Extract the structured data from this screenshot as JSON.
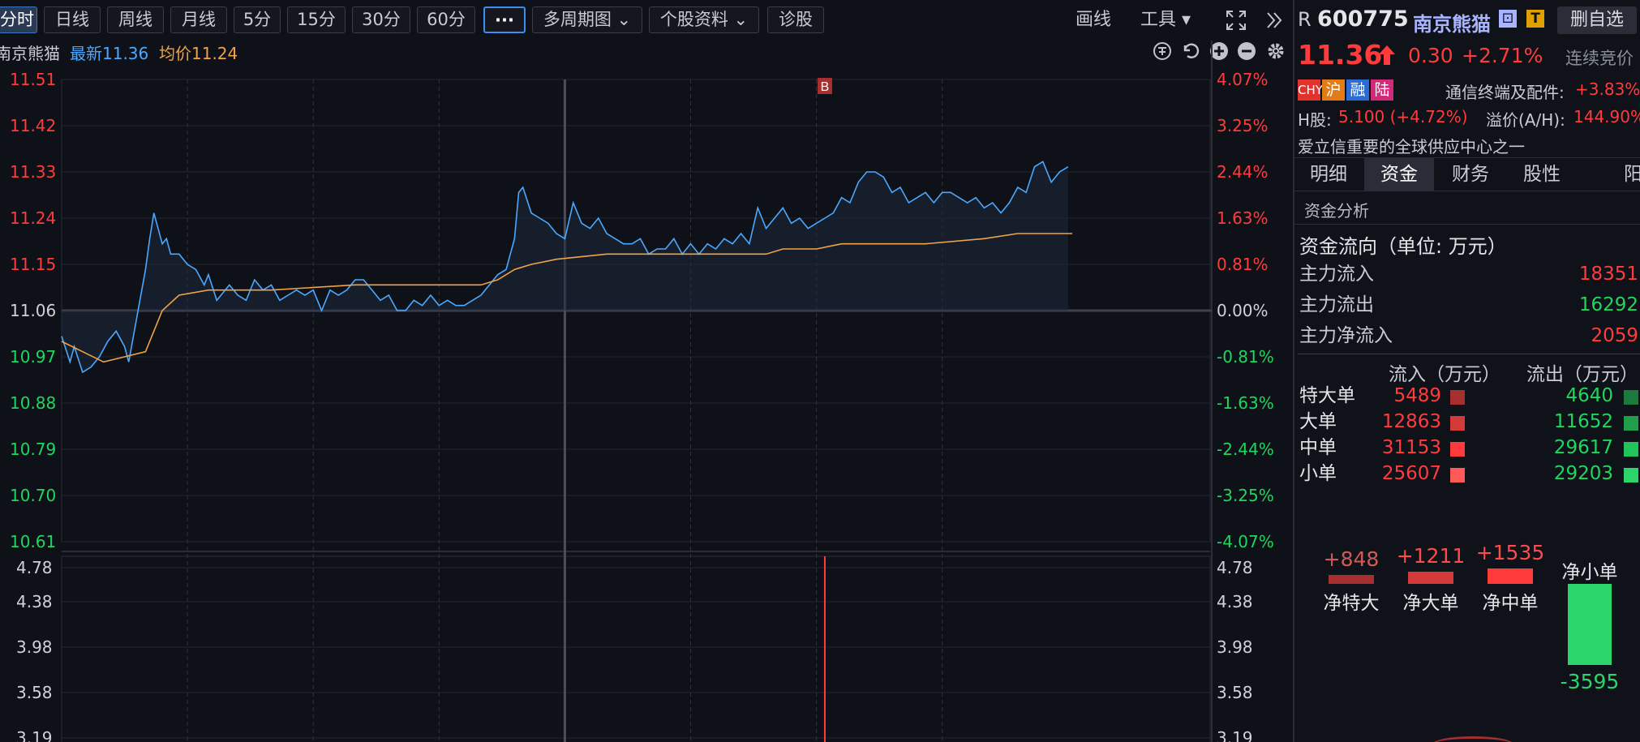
{
  "toolbar": {
    "periods": [
      "分时",
      "日线",
      "周线",
      "月线",
      "5分",
      "15分",
      "30分",
      "60分"
    ],
    "more_label": "···",
    "multi_label": "多周期图 ⌄",
    "profile_label": "个股资料 ⌄",
    "diagnose_label": "诊股",
    "draw_label": "画线",
    "tools_label": "工具 ▾",
    "fullscreen_icon": "fullscreen-icon",
    "collapse_icon": "double-chevron-right-icon"
  },
  "infobar": {
    "name": "南京熊猫",
    "latest": "最新11.36",
    "avg": "均价11.24"
  },
  "marker": "B",
  "price_axis": {
    "left": [
      "11.51",
      "11.42",
      "11.33",
      "11.24",
      "11.15",
      "11.06",
      "10.97",
      "10.88",
      "10.79",
      "10.70",
      "10.61"
    ],
    "right": [
      "4.07%",
      "3.25%",
      "2.44%",
      "1.63%",
      "0.81%",
      "0.00%",
      "-0.81%",
      "-1.63%",
      "-2.44%",
      "-3.25%",
      "-4.07%"
    ]
  },
  "vol_axis": {
    "left": [
      "4.78",
      "4.38",
      "3.98",
      "3.58",
      "3.19"
    ],
    "right": [
      "4.78",
      "4.38",
      "3.98",
      "3.58",
      "3.19"
    ]
  },
  "chart_data": {
    "type": "line",
    "x_count": 241,
    "ylim": [
      10.61,
      11.51
    ],
    "prev_close": 11.06,
    "series": [
      {
        "key": "price",
        "color": "#4aa8ff",
        "points": [
          [
            0,
            11.01
          ],
          [
            2,
            10.96
          ],
          [
            3,
            10.99
          ],
          [
            5,
            10.94
          ],
          [
            7,
            10.95
          ],
          [
            9,
            10.97
          ],
          [
            11,
            11.0
          ],
          [
            13,
            11.02
          ],
          [
            15,
            10.99
          ],
          [
            16,
            10.96
          ],
          [
            18,
            11.05
          ],
          [
            20,
            11.14
          ],
          [
            21,
            11.2
          ],
          [
            22,
            11.25
          ],
          [
            24,
            11.19
          ],
          [
            25,
            11.2
          ],
          [
            26,
            11.17
          ],
          [
            28,
            11.17
          ],
          [
            30,
            11.15
          ],
          [
            32,
            11.14
          ],
          [
            34,
            11.11
          ],
          [
            35,
            11.13
          ],
          [
            37,
            11.08
          ],
          [
            38,
            11.09
          ],
          [
            40,
            11.11
          ],
          [
            42,
            11.09
          ],
          [
            44,
            11.08
          ],
          [
            46,
            11.12
          ],
          [
            48,
            11.1
          ],
          [
            50,
            11.11
          ],
          [
            52,
            11.08
          ],
          [
            54,
            11.09
          ],
          [
            56,
            11.1
          ],
          [
            58,
            11.09
          ],
          [
            60,
            11.1
          ],
          [
            62,
            11.06
          ],
          [
            64,
            11.1
          ],
          [
            66,
            11.09
          ],
          [
            68,
            11.1
          ],
          [
            70,
            11.12
          ],
          [
            72,
            11.12
          ],
          [
            74,
            11.1
          ],
          [
            76,
            11.08
          ],
          [
            78,
            11.09
          ],
          [
            80,
            11.06
          ],
          [
            82,
            11.06
          ],
          [
            84,
            11.08
          ],
          [
            86,
            11.07
          ],
          [
            88,
            11.09
          ],
          [
            90,
            11.07
          ],
          [
            92,
            11.08
          ],
          [
            94,
            11.07
          ],
          [
            96,
            11.07
          ],
          [
            98,
            11.08
          ],
          [
            100,
            11.09
          ],
          [
            102,
            11.11
          ],
          [
            104,
            11.13
          ],
          [
            106,
            11.14
          ],
          [
            108,
            11.2
          ],
          [
            109,
            11.29
          ],
          [
            110,
            11.3
          ],
          [
            112,
            11.25
          ],
          [
            114,
            11.24
          ],
          [
            116,
            11.23
          ],
          [
            118,
            11.21
          ],
          [
            120,
            11.2
          ],
          [
            122,
            11.27
          ],
          [
            124,
            11.23
          ],
          [
            126,
            11.22
          ],
          [
            128,
            11.24
          ],
          [
            130,
            11.21
          ],
          [
            132,
            11.2
          ],
          [
            134,
            11.19
          ],
          [
            136,
            11.19
          ],
          [
            138,
            11.2
          ],
          [
            140,
            11.17
          ],
          [
            142,
            11.18
          ],
          [
            144,
            11.18
          ],
          [
            146,
            11.2
          ],
          [
            148,
            11.17
          ],
          [
            150,
            11.19
          ],
          [
            152,
            11.17
          ],
          [
            154,
            11.19
          ],
          [
            156,
            11.18
          ],
          [
            158,
            11.2
          ],
          [
            160,
            11.19
          ],
          [
            162,
            11.21
          ],
          [
            164,
            11.19
          ],
          [
            166,
            11.26
          ],
          [
            168,
            11.22
          ],
          [
            170,
            11.24
          ],
          [
            172,
            11.26
          ],
          [
            174,
            11.23
          ],
          [
            176,
            11.24
          ],
          [
            178,
            11.22
          ],
          [
            180,
            11.23
          ],
          [
            182,
            11.24
          ],
          [
            184,
            11.25
          ],
          [
            186,
            11.28
          ],
          [
            188,
            11.27
          ],
          [
            190,
            11.31
          ],
          [
            192,
            11.33
          ],
          [
            194,
            11.33
          ],
          [
            196,
            11.32
          ],
          [
            198,
            11.29
          ],
          [
            200,
            11.3
          ],
          [
            202,
            11.27
          ],
          [
            204,
            11.28
          ],
          [
            206,
            11.29
          ],
          [
            208,
            11.27
          ],
          [
            210,
            11.29
          ],
          [
            212,
            11.29
          ],
          [
            214,
            11.28
          ],
          [
            216,
            11.27
          ],
          [
            218,
            11.28
          ],
          [
            220,
            11.26
          ],
          [
            222,
            11.27
          ],
          [
            224,
            11.25
          ],
          [
            226,
            11.27
          ],
          [
            228,
            11.3
          ],
          [
            230,
            11.29
          ],
          [
            232,
            11.34
          ],
          [
            234,
            11.35
          ],
          [
            236,
            11.31
          ],
          [
            238,
            11.33
          ],
          [
            240,
            11.34
          ]
        ]
      },
      {
        "key": "avg",
        "color": "#f0a347",
        "points": [
          [
            0,
            11.0
          ],
          [
            5,
            10.98
          ],
          [
            10,
            10.96
          ],
          [
            15,
            10.97
          ],
          [
            20,
            10.98
          ],
          [
            22,
            11.02
          ],
          [
            24,
            11.06
          ],
          [
            28,
            11.09
          ],
          [
            35,
            11.1
          ],
          [
            50,
            11.1
          ],
          [
            70,
            11.11
          ],
          [
            90,
            11.11
          ],
          [
            100,
            11.11
          ],
          [
            104,
            11.12
          ],
          [
            108,
            11.14
          ],
          [
            112,
            11.15
          ],
          [
            118,
            11.16
          ],
          [
            130,
            11.17
          ],
          [
            140,
            11.17
          ],
          [
            150,
            11.17
          ],
          [
            160,
            11.17
          ],
          [
            164,
            11.17
          ],
          [
            168,
            11.17
          ],
          [
            172,
            11.18
          ],
          [
            178,
            11.18
          ],
          [
            180,
            11.18
          ],
          [
            186,
            11.19
          ],
          [
            190,
            11.19
          ],
          [
            198,
            11.19
          ],
          [
            206,
            11.19
          ],
          [
            220,
            11.2
          ],
          [
            228,
            11.21
          ],
          [
            234,
            11.21
          ],
          [
            238,
            11.21
          ],
          [
            241,
            11.21
          ]
        ]
      }
    ]
  },
  "vol_data": {
    "type": "bar",
    "bars": [
      {
        "x": 182,
        "v": 4.78,
        "color": "#ff3b3b"
      }
    ]
  },
  "quote": {
    "prefix": "R",
    "code": "600775",
    "name": "南京熊猫",
    "price": "11.36",
    "change": "0.30",
    "pct": "+2.71%",
    "status": "连续竞价",
    "delete_label": "删自选",
    "badges": [
      {
        "t": "CHY",
        "c": "#e2322e"
      },
      {
        "t": "沪",
        "c": "#e37b16"
      },
      {
        "t": "融",
        "c": "#2a6bd6"
      },
      {
        "t": "陆",
        "c": "#d22a7a"
      }
    ],
    "sector_label": "通信终端及配件:",
    "sector_value": "+3.83%",
    "h_label": "H股:",
    "h_value": "5.100 (+4.72%)",
    "premium_label": "溢价(A/H):",
    "premium_value": "144.90%",
    "note": "爱立信重要的全球供应中心之一"
  },
  "tabs": [
    "明细",
    "资金",
    "财务",
    "股性",
    "阳"
  ],
  "fund": {
    "section": "资金分析",
    "flow_title": "资金流向（单位: 万元）",
    "rows": [
      {
        "k": "主力流入",
        "v": "18351",
        "c": "up"
      },
      {
        "k": "主力流出",
        "v": "16292",
        "c": "dn"
      },
      {
        "k": "主力净流入",
        "v": "2059",
        "c": "up"
      }
    ],
    "head_in": "流入（万元）",
    "head_out": "流出（万元）",
    "orders": [
      {
        "k": "特大单",
        "in": "5489",
        "out": "4640",
        "ic": "#a6302f",
        "oc": "#1b7a3c"
      },
      {
        "k": "大单",
        "in": "12863",
        "out": "11652",
        "ic": "#d53a3a",
        "oc": "#1f9e4c"
      },
      {
        "k": "中单",
        "in": "31153",
        "out": "29617",
        "ic": "#ff3a3a",
        "oc": "#22c25c"
      },
      {
        "k": "小单",
        "in": "25607",
        "out": "29203",
        "ic": "#ff5a5a",
        "oc": "#2bd56b"
      }
    ],
    "net": [
      {
        "label": "净特大",
        "value": "+848",
        "num": 848,
        "color": "#a6302f"
      },
      {
        "label": "净大单",
        "value": "+1211",
        "num": 1211,
        "color": "#d53a3a"
      },
      {
        "label": "净中单",
        "value": "+1535",
        "num": 1535,
        "color": "#ff3a3a"
      },
      {
        "label": "净小单",
        "value": "-3595",
        "num": -3595,
        "color": "#2bd56b"
      }
    ]
  }
}
